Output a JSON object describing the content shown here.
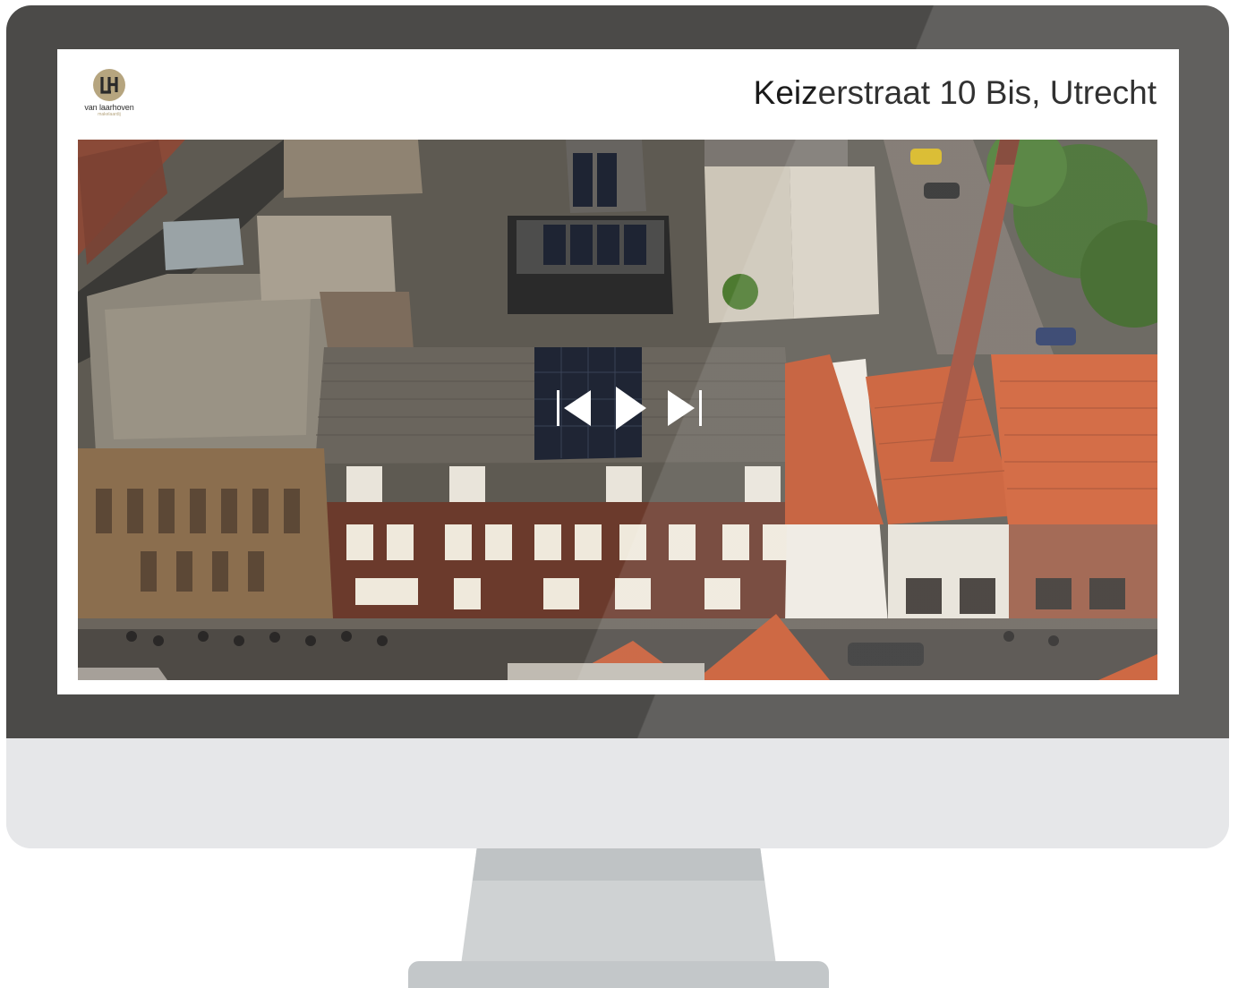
{
  "listing": {
    "title": "Keizerstraat 10 Bis, Utrecht"
  },
  "logo": {
    "monogram": "LH",
    "name": "van laarhoven",
    "tagline": "makelaardij"
  },
  "colors": {
    "bezel": "#4b4a48",
    "chin": "#e6e7e9",
    "stand": "#cfd2d3",
    "logo_gold": "#b6a57f",
    "control_arrow": "#ffffff"
  },
  "photo": {
    "description_icon": "aerial-street-photo"
  },
  "controls": {
    "previous_icon": "skip-previous-icon",
    "play_icon": "play-icon",
    "next_icon": "skip-next-icon"
  }
}
